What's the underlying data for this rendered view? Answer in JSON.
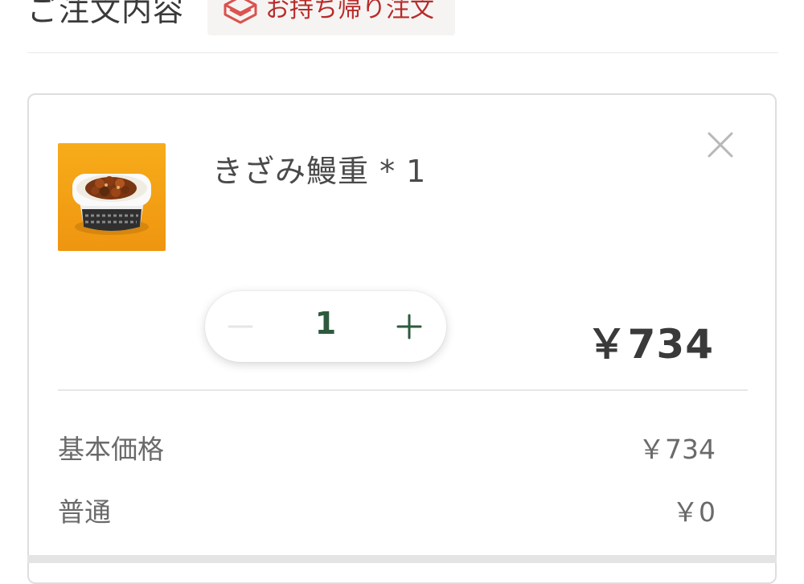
{
  "header": {
    "title": "ご注文内容",
    "takeout_badge": {
      "label": "お持ち帰り注文",
      "icon": "takeout-box-icon",
      "color": "#b82b2b"
    }
  },
  "order_item": {
    "name": "きざみ鰻重 * 1",
    "image": "kizami-unaju-photo",
    "quantity": "1",
    "price": "￥734",
    "close_icon": "close-icon",
    "minus_icon": "minus-icon",
    "plus_icon": "plus-icon",
    "accent_color": "#2d5a3e",
    "breakdown": [
      {
        "label": "基本価格",
        "value": "￥734"
      },
      {
        "label": "普通",
        "value": "￥0"
      }
    ]
  }
}
